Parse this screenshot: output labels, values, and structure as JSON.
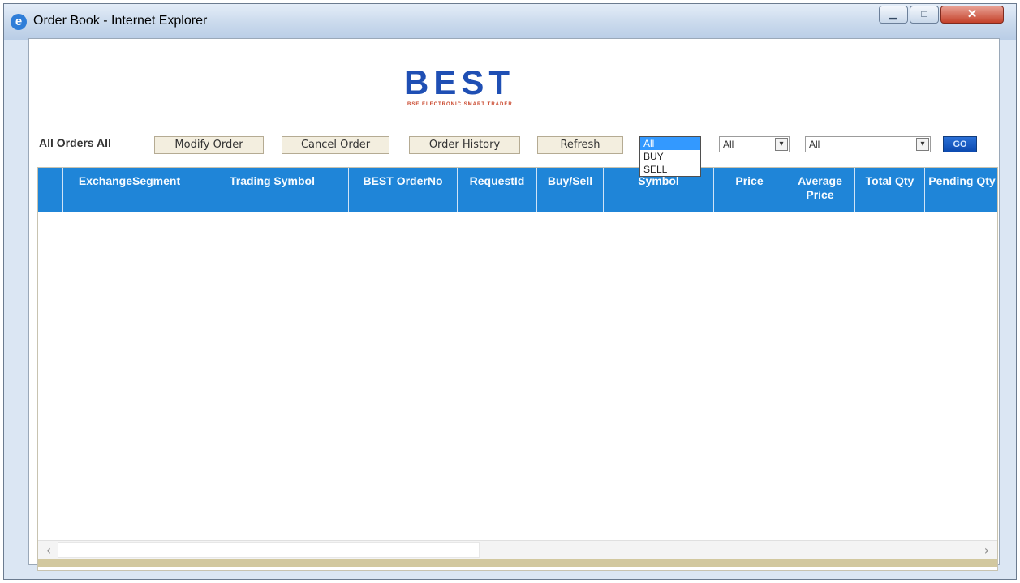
{
  "window": {
    "title": "Order Book - Internet Explorer"
  },
  "logo": {
    "text": "BEST",
    "subtext": "BSE ELECTRONIC SMART TRADER"
  },
  "toolbar": {
    "label": "All Orders All",
    "modify": "Modify Order",
    "cancel": "Cancel Order",
    "history": "Order History",
    "refresh": "Refresh",
    "select1": {
      "value": "All",
      "options": [
        "All",
        "BUY",
        "SELL"
      ]
    },
    "select2": {
      "value": "All"
    },
    "select3": {
      "value": "All"
    },
    "go": "GO"
  },
  "table": {
    "columns": [
      "ExchangeSegment",
      "Trading Symbol",
      "BEST OrderNo",
      "RequestId",
      "Buy/Sell",
      "Symbol",
      "Price",
      "Average Price",
      "Total Qty",
      "Pending Qty"
    ]
  },
  "scroll": {
    "left": "‹",
    "right": "›"
  },
  "colors": {
    "header_bg": "#1f85d8",
    "button_bg": "#f3eedf",
    "accent": "#0c4ab0"
  }
}
